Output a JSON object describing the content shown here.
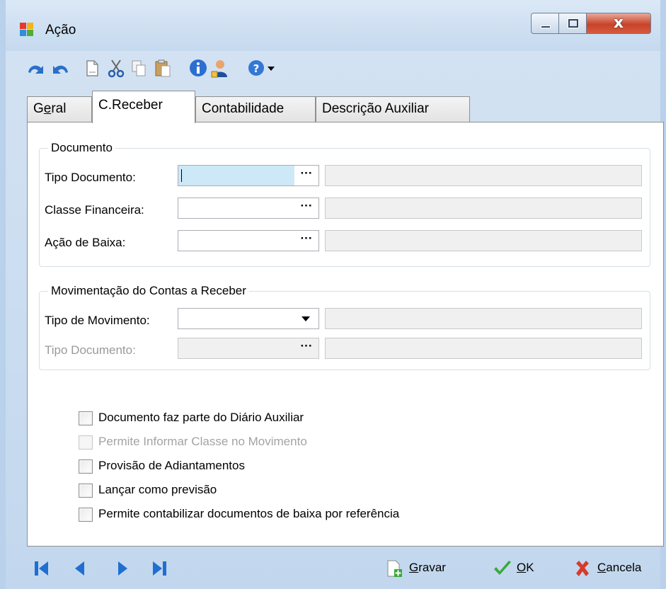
{
  "window": {
    "title": "Ação",
    "close_glyph": "x"
  },
  "toolbar": {
    "icons": [
      "undo-icon",
      "redo-icon",
      "new-document-icon",
      "cut-icon",
      "copy-icon",
      "paste-icon",
      "info-icon",
      "user-icon",
      "help-icon",
      "dropdown-arrow-icon"
    ]
  },
  "tabs": [
    {
      "label_pre": "G",
      "label_u": "e",
      "label_post": "ral",
      "active": false
    },
    {
      "label": "C.Receber",
      "active": true
    },
    {
      "label": "Contabilidade",
      "active": false
    },
    {
      "label": "Descrição Auxiliar",
      "active": false
    }
  ],
  "documento": {
    "title": "Documento",
    "tipo_documento_label": "Tipo Documento:",
    "classe_financeira_label": "Classe Financeira:",
    "acao_baixa_label": "Ação de Baixa:",
    "lookup_button": "···"
  },
  "movimentacao": {
    "title": "Movimentação do Contas a Receber",
    "tipo_movimento_label": "Tipo de Movimento:",
    "tipo_documento_label": "Tipo Documento:",
    "lookup_button": "···"
  },
  "checkboxes": [
    {
      "label": "Documento faz parte do Diário Auxiliar",
      "checked": false,
      "disabled": false
    },
    {
      "label": "Permite Informar Classe no Movimento",
      "checked": false,
      "disabled": true
    },
    {
      "label": "Provisão de Adiantamentos",
      "checked": false,
      "disabled": false
    },
    {
      "label": "Lançar como previsão",
      "checked": false,
      "disabled": false
    },
    {
      "label": "Permite contabilizar documentos de baixa por referência",
      "checked": false,
      "disabled": false
    }
  ],
  "navigation": {
    "icons": [
      "first-record-icon",
      "previous-record-icon",
      "next-record-icon",
      "last-record-icon"
    ]
  },
  "actions": {
    "save_u": "G",
    "save_rest": "ravar",
    "ok_u": "O",
    "ok_rest": "K",
    "cancel_u": "C",
    "cancel_rest": "ancela"
  },
  "colors": {
    "accent_blue": "#1f6fd1",
    "focus_field": "#cde8f7",
    "ok_green": "#3aa83a",
    "cancel_red": "#d83a2a"
  }
}
